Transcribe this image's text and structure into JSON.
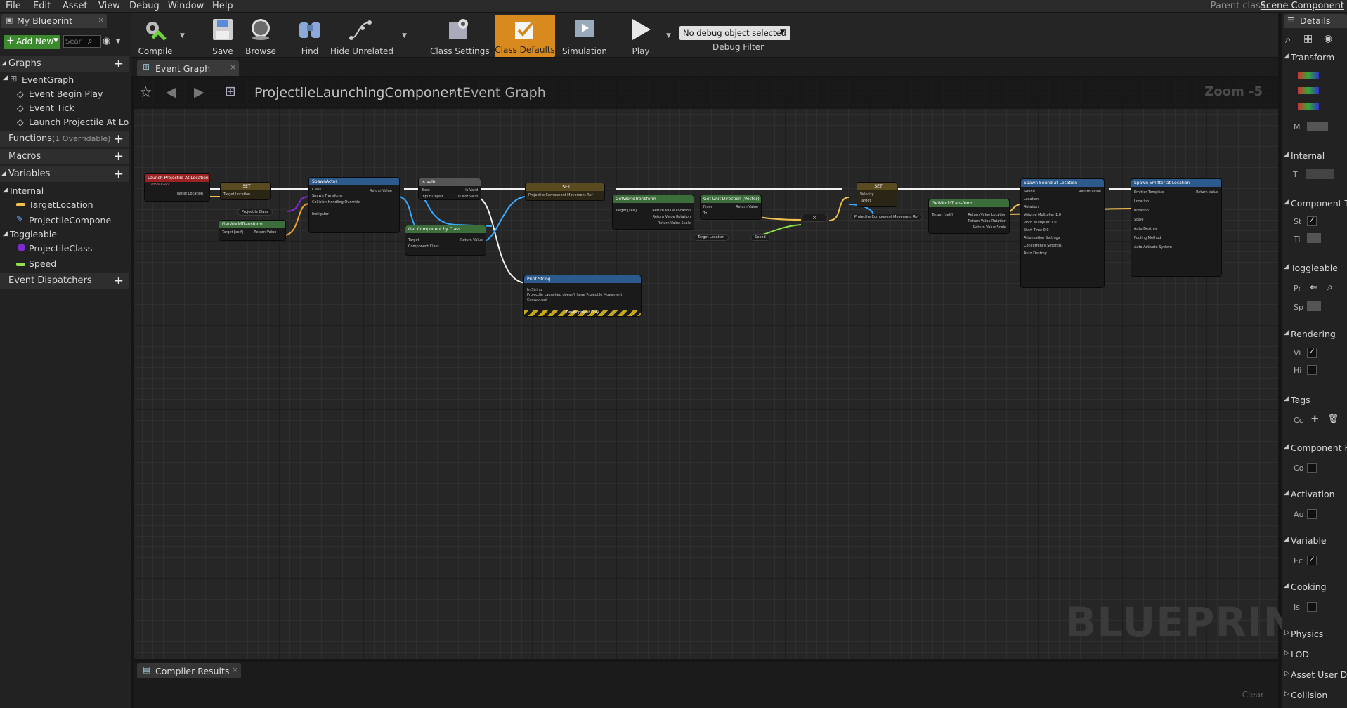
{
  "menu": {
    "items": [
      "File",
      "Edit",
      "Asset",
      "View",
      "Debug",
      "Window",
      "Help"
    ],
    "parent_class_label": "Parent class:",
    "parent_class_value": "Scene Component"
  },
  "left_panel": {
    "tab": "My Blueprint",
    "add_new": "Add New",
    "search_placeholder": "Sear",
    "graphs_label": "Graphs",
    "event_graph": "EventGraph",
    "graph_items": [
      "Event Begin Play",
      "Event Tick",
      "Launch Projectile At Lo"
    ],
    "functions_label": "Functions",
    "functions_note": "(1 Overridable)",
    "macros_label": "Macros",
    "variables_label": "Variables",
    "internal_label": "Internal",
    "internal_vars": [
      "TargetLocation",
      "ProjectileComponen"
    ],
    "toggleable_label": "Toggleable",
    "toggleable_vars": [
      "ProjectileClass",
      "Speed"
    ],
    "dispatchers_label": "Event Dispatchers"
  },
  "toolbar": {
    "compile": "Compile",
    "save": "Save",
    "browse": "Browse",
    "find": "Find",
    "hide_unrelated": "Hide Unrelated",
    "class_settings": "Class Settings",
    "class_defaults": "Class Defaults",
    "simulation": "Simulation",
    "play": "Play",
    "debug_select": "No debug object selected",
    "debug_filter": "Debug Filter"
  },
  "graph": {
    "tab": "Event Graph",
    "breadcrumb_owner": "ProjectileLaunchingComponent",
    "breadcrumb_graph": "Event Graph",
    "zoom": "Zoom -5",
    "watermark": "BLUEPRINT",
    "nodes": {
      "launch_event": "Launch Projectile At Location",
      "launch_event_sub": "Custom Event",
      "launch_pin": "Target Location",
      "set1": "SET",
      "set1_pin": "Target Location",
      "projectile_class": "Projectile Class",
      "get_world_1": "GetWorldTransform",
      "get_world_1_pin": "Target [self]",
      "return_value": "Return Value",
      "spawn_actor": "SpawnActor",
      "spawn_pins": [
        "Class",
        "Spawn Transform",
        "Collision Handling Override",
        "Instigator"
      ],
      "is_valid": "Is Valid",
      "is_valid_pins": [
        "Exec",
        "Input Object",
        "Is Valid",
        "Is Not Valid"
      ],
      "get_component": "Get Component by Class",
      "get_component_pins": [
        "Target",
        "Component Class"
      ],
      "set2": "SET",
      "set2_pin": "Projectile Component Movement Ref",
      "print_string": "Print String",
      "print_pins": [
        "In String",
        "Projectile Launched doesn't have Projectile Movement Component"
      ],
      "dev_only": "Development Only",
      "get_world_2": "GetWorldTransform",
      "get_world_2_pins": [
        "Target [self]",
        "Return Value Location",
        "Return Value Rotation",
        "Return Value Scale"
      ],
      "unit_dir": "Get Unit Direction (Vector)",
      "unit_dir_pins": [
        "From",
        "To"
      ],
      "target_location": "Target Location",
      "speed": "Speed",
      "set3": "SET",
      "set3_pins": [
        "Velocity",
        "Target"
      ],
      "movement_ref": "Projectile Component Movement Ref",
      "get_world_3": "GetWorldTransform",
      "spawn_sound": "Spawn Sound at Location",
      "spawn_sound_pins": [
        "Sound",
        "Location",
        "Rotation",
        "Volume Multiplier 1.0",
        "Pitch Multiplier 1.0",
        "Start Time 0.0",
        "Attenuation Settings",
        "Concurrency Settings",
        "Auto Destroy"
      ],
      "spawn_emitter": "Spawn Emitter at Location",
      "spawn_emitter_pins": [
        "Emitter Template",
        "Location",
        "Rotation",
        "Scale",
        "Auto Destroy",
        "Pooling Method",
        "Auto Activate System"
      ]
    }
  },
  "compiler": {
    "tab": "Compiler Results",
    "clear": "Clear"
  },
  "details": {
    "tab": "Details",
    "sections": [
      "Transform",
      "Internal",
      "Component T",
      "Toggleable",
      "Rendering",
      "Tags",
      "Component R",
      "Activation",
      "Variable",
      "Cooking",
      "Physics",
      "LOD",
      "Asset User D",
      "Collision"
    ],
    "labels": {
      "m": "M",
      "t": "T",
      "st": "St",
      "ti": "Ti",
      "pr": "Pr",
      "sp": "Sp",
      "vi": "Vi",
      "hi": "Hi",
      "cc": "Cc",
      "co": "Co",
      "au": "Au",
      "ec": "Ec",
      "is": "Is"
    }
  }
}
